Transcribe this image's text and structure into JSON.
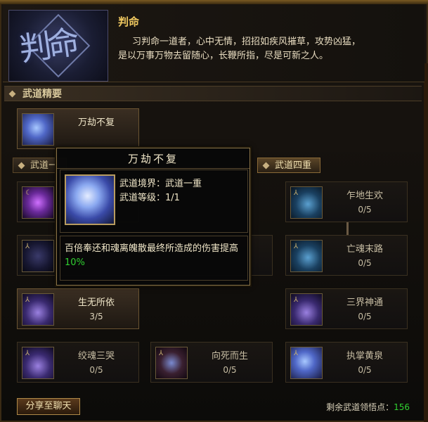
{
  "header": {
    "emblem_text": "判命",
    "title": "判命",
    "desc_line1": "习判命一道者，心中无情，招招如疾风摧草，攻势凶猛，",
    "desc_line2": "是以万事万物去留随心，长鞭所指，尽是可新之人。"
  },
  "section_essentials": {
    "label": "武道精要",
    "card": {
      "name": "万劫不复"
    }
  },
  "tabs": [
    {
      "label": "武道一"
    },
    {
      "label": "武道四重"
    }
  ],
  "tooltip": {
    "title": "万劫不复",
    "realm_label": "武道境界：武道一重",
    "level_label": "武道等级：1/1",
    "desc_text": "百倍奉还和魂离魄散最终所造成的伤害提高",
    "desc_percent": "10%"
  },
  "skills": {
    "right1": {
      "name": "乍地生欢",
      "level": "0/5"
    },
    "right2": {
      "name": "亡魂末路",
      "level": "0/5"
    },
    "left3": {
      "name": "生无所依",
      "level": "3/5"
    },
    "right3": {
      "name": "三界神通",
      "level": "0/5"
    },
    "b1": {
      "name": "绞魂三哭",
      "level": "0/5"
    },
    "b2": {
      "name": "向死而生",
      "level": "0/5"
    },
    "b3": {
      "name": "执掌黄泉",
      "level": "0/5"
    }
  },
  "footer": {
    "share_label": "分享至聊天",
    "remain_label": "剩余武道领悟点：",
    "remain_value": "156"
  }
}
